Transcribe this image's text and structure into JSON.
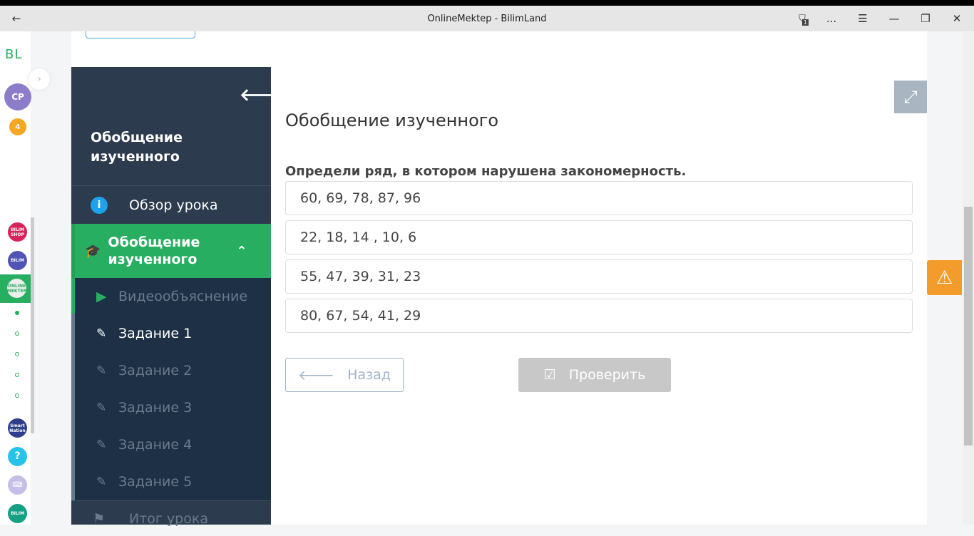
{
  "window": {
    "title": "OnlineMektep - BilimLand",
    "back_icon": "←",
    "notif_count": "1",
    "more": "...",
    "menu": "☰",
    "minimize": "—",
    "restore": "❐",
    "close": "✕"
  },
  "rail": {
    "logo": "BL",
    "avatar": "CP",
    "badge": "4",
    "apps": [
      "BILIM SHOP",
      "BILIM",
      "ONLINE MEKTEP",
      "Smart Nation",
      "?",
      "",
      "BILIM"
    ]
  },
  "sidebar": {
    "title": "Обобщение изученного",
    "overview": "Обзор урока",
    "section": "Обобщение изученного",
    "video": "Видеообъяснение",
    "tasks": [
      "Задание 1",
      "Задание 2",
      "Задание 3",
      "Задание 4",
      "Задание 5"
    ],
    "summary": "Итог урока"
  },
  "main": {
    "title": "Обобщение изученного",
    "question": "Определи ряд, в котором нарушена закономерность.",
    "options": [
      "60, 69, 78, 87, 96",
      "22, 18, 14 , 10, 6",
      "55, 47, 39, 31, 23",
      "80, 67, 54, 41, 29"
    ],
    "back": "Назад",
    "check": "Проверить"
  },
  "colors": {
    "green": "#27ae60",
    "sidebar": "#2c3b4d",
    "submenu": "#1d3046",
    "warning": "#f39c2b"
  }
}
